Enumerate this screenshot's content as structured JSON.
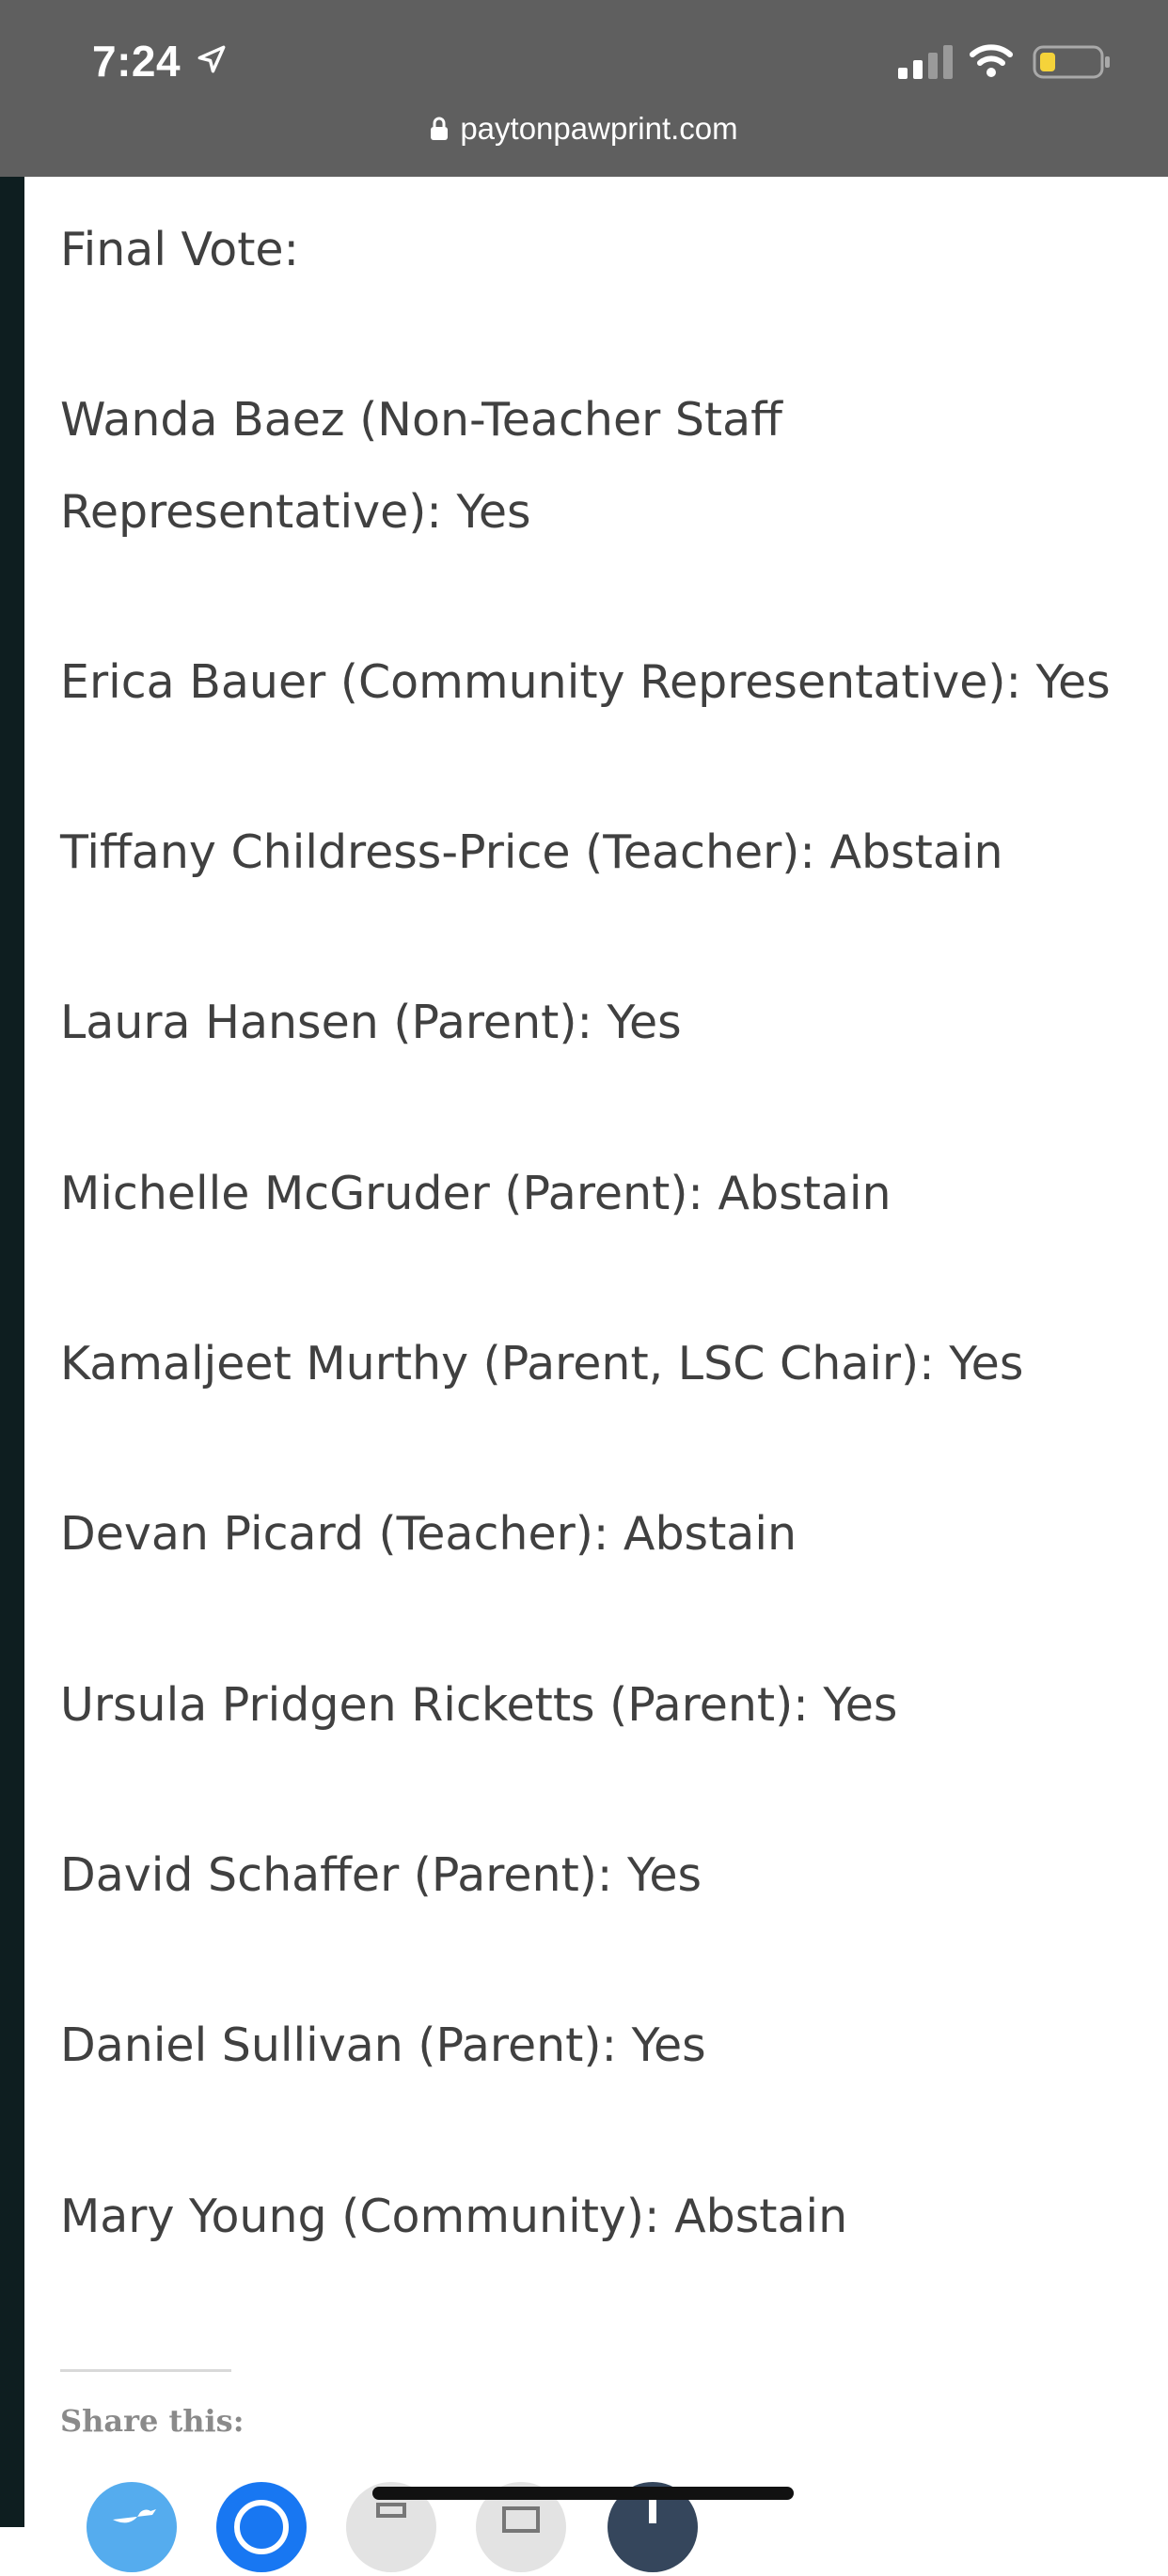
{
  "status_bar": {
    "time": "7:24",
    "url": "paytonpawprint.com"
  },
  "article": {
    "heading": "Final Vote:",
    "votes": [
      {
        "line1": "Wanda Baez (Non-Teacher Staff",
        "line2": "Representative): Yes"
      },
      {
        "line1": "Erica Bauer (Community Representative): Yes"
      },
      {
        "line1": "Tiffany Childress-Price (Teacher): Abstain"
      },
      {
        "line1": "Laura Hansen (Parent): Yes"
      },
      {
        "line1": "Michelle McGruder (Parent): Abstain"
      },
      {
        "line1": "Kamaljeet Murthy (Parent, LSC Chair): Yes"
      },
      {
        "line1": "Devan Picard (Teacher): Abstain"
      },
      {
        "line1": "Ursula Pridgen Ricketts (Parent): Yes"
      },
      {
        "line1": "David Schaffer (Parent): Yes"
      },
      {
        "line1": "Daniel Sullivan (Parent): Yes"
      },
      {
        "line1": "Mary Young (Community): Abstain"
      }
    ]
  },
  "share": {
    "title": "Share this:",
    "buttons": [
      {
        "icon": "twitter-icon",
        "color": "#55acee"
      },
      {
        "icon": "facebook-icon",
        "color": "#1877f2"
      },
      {
        "icon": "print-icon",
        "color": "#e3e3e3"
      },
      {
        "icon": "email-icon",
        "color": "#e3e3e3"
      },
      {
        "icon": "tumblr-icon",
        "color": "#35465c"
      }
    ]
  }
}
